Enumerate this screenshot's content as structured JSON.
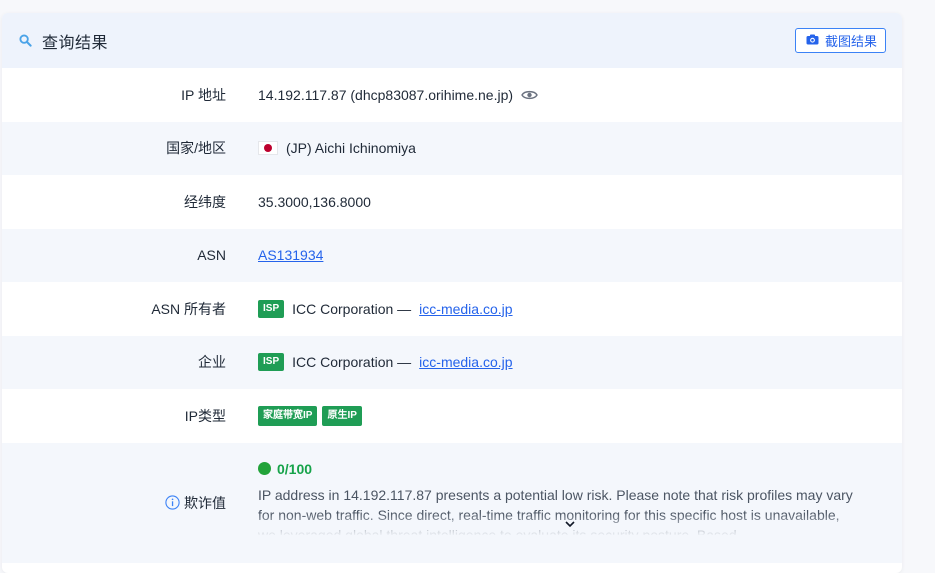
{
  "header": {
    "title": "查询结果",
    "screenshot_button": "截图结果",
    "accent": "#2563eb"
  },
  "rows": [
    {
      "label": "IP 地址",
      "value": "14.192.117.87 (dhcp83087.orihime.ne.jp)"
    },
    {
      "label": "国家/地区",
      "value": "(JP) Aichi Ichinomiya"
    },
    {
      "label": "经纬度",
      "value": "35.3000,136.8000"
    },
    {
      "label": "ASN",
      "value": "AS131934"
    },
    {
      "label": "ASN 所有者",
      "badge": "ISP",
      "value": "ICC Corporation —",
      "link": "icc-media.co.jp"
    },
    {
      "label": "企业",
      "badge": "ISP",
      "value": "ICC Corporation —",
      "link": "icc-media.co.jp"
    },
    {
      "label": "IP类型",
      "badges": [
        "家庭带宽IP",
        "原生IP"
      ]
    }
  ],
  "risk": {
    "label": "欺诈值",
    "score": "0/100",
    "score_color": "#22a33a",
    "description": "IP address in 14.192.117.87 presents a potential low risk. Please note that risk profiles may vary for non-web traffic. Since direct, real-time traffic monitoring for this specific host is unavailable, we leveraged global threat intelligence to evaluate its security posture. Based"
  }
}
